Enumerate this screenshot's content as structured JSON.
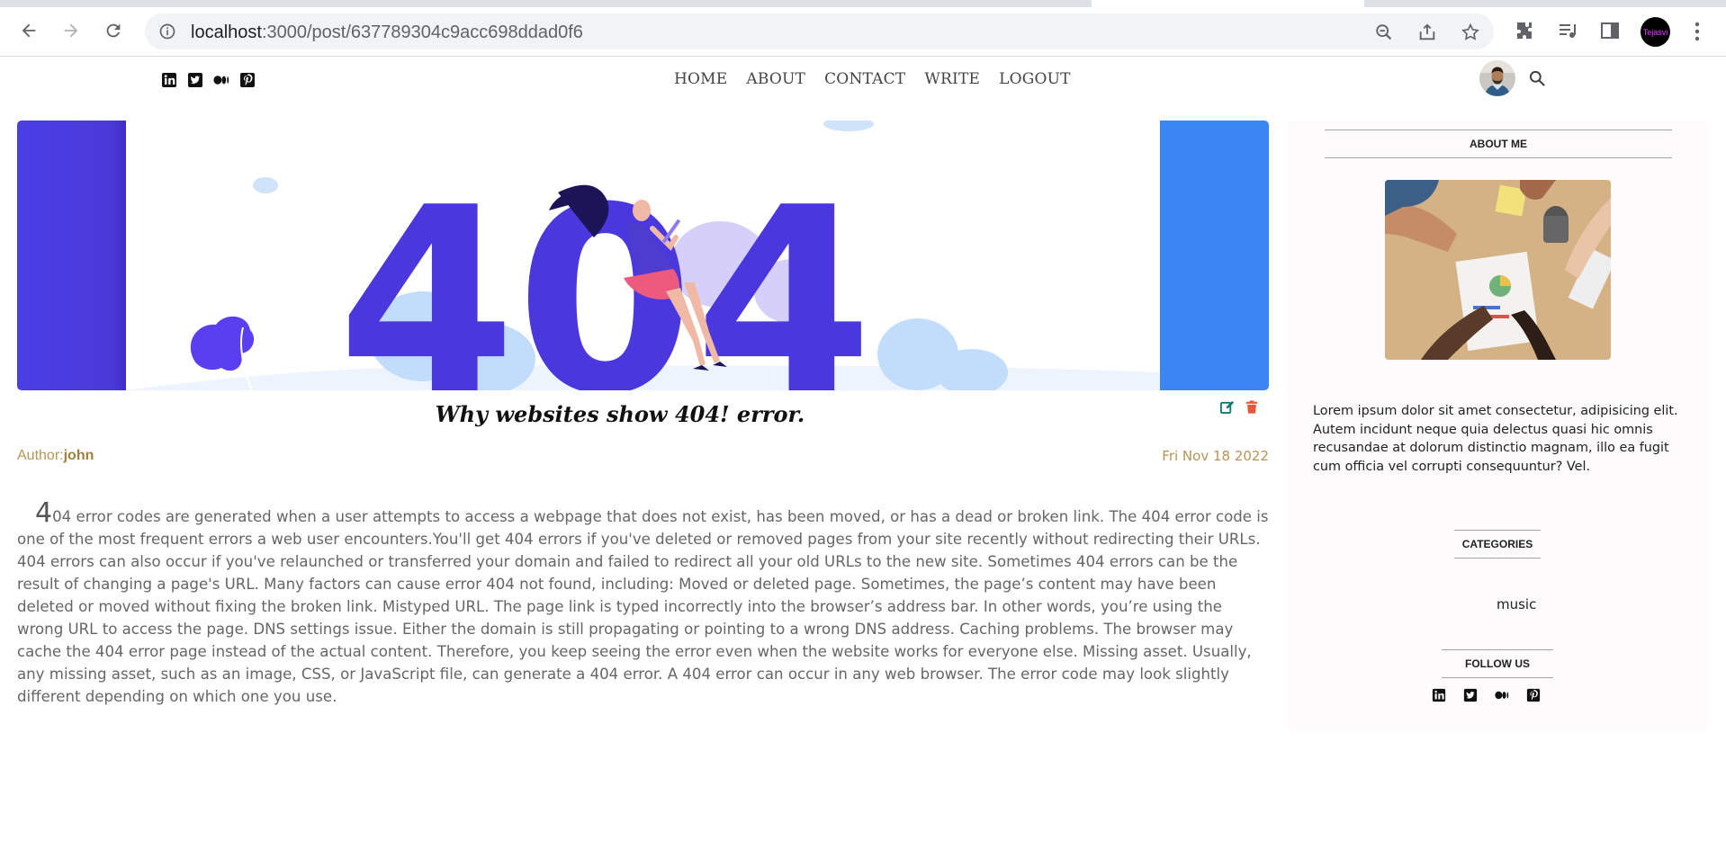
{
  "browser": {
    "url_host": "localhost",
    "url_path": ":3000/post/637789304c9acc698ddad0f6",
    "profile_label": "Tejasvi"
  },
  "header": {
    "nav": [
      "HOME",
      "ABOUT",
      "CONTACT",
      "WRITE",
      "LOGOUT"
    ],
    "social_icons": [
      "linkedin-icon",
      "twitter-icon",
      "medium-icon",
      "pinterest-icon"
    ]
  },
  "post": {
    "title": "Why websites show 404! error.",
    "author_label": "Author:",
    "author_name": "john",
    "date": "Fri Nov 18 2022",
    "body_first_letter": "4",
    "body_rest": "04 error codes are generated when a user attempts to access a webpage that does not exist, has been moved, or has a dead or broken link. The 404 error code is one of the most frequent errors a web user encounters.You'll get 404 errors if you've deleted or removed pages from your site recently without redirecting their URLs. 404 errors can also occur if you've relaunched or transferred your domain and failed to redirect all your old URLs to the new site. Sometimes 404 errors can be the result of changing a page's URL. Many factors can cause error 404 not found, including: Moved or deleted page. Sometimes, the page’s content may have been deleted or moved without fixing the broken link. Mistyped URL. The page link is typed incorrectly into the browser’s address bar. In other words, you’re using the wrong URL to access the page. DNS settings issue. Either the domain is still propagating or pointing to a wrong DNS address. Caching problems. The browser may cache the 404 error page instead of the actual content. Therefore, you keep seeing the error even when the website works for everyone else. Missing asset. Usually, any missing asset, such as an image, CSS, or JavaScript file, can generate a 404 error. A 404 error can occur in any web browser. The error code may look slightly different depending on which one you use.",
    "hero_text": "404"
  },
  "sidebar": {
    "about_title": "ABOUT ME",
    "about_text": "Lorem ipsum dolor sit amet consectetur, adipisicing elit. Autem incidunt neque quia delectus quasi hic omnis recusandae at dolorum distinctio magnam, illo ea fugit cum officia vel corrupti consequuntur? Vel.",
    "categories_title": "CATEGORIES",
    "categories": [
      "music"
    ],
    "follow_title": "FOLLOW US"
  },
  "colors": {
    "accent_purple": "#4a3ee6",
    "accent_blue": "#3b86f2",
    "meta_gold": "#b39656",
    "edit_teal": "#0f7a6b",
    "delete_red": "#e8553a"
  }
}
